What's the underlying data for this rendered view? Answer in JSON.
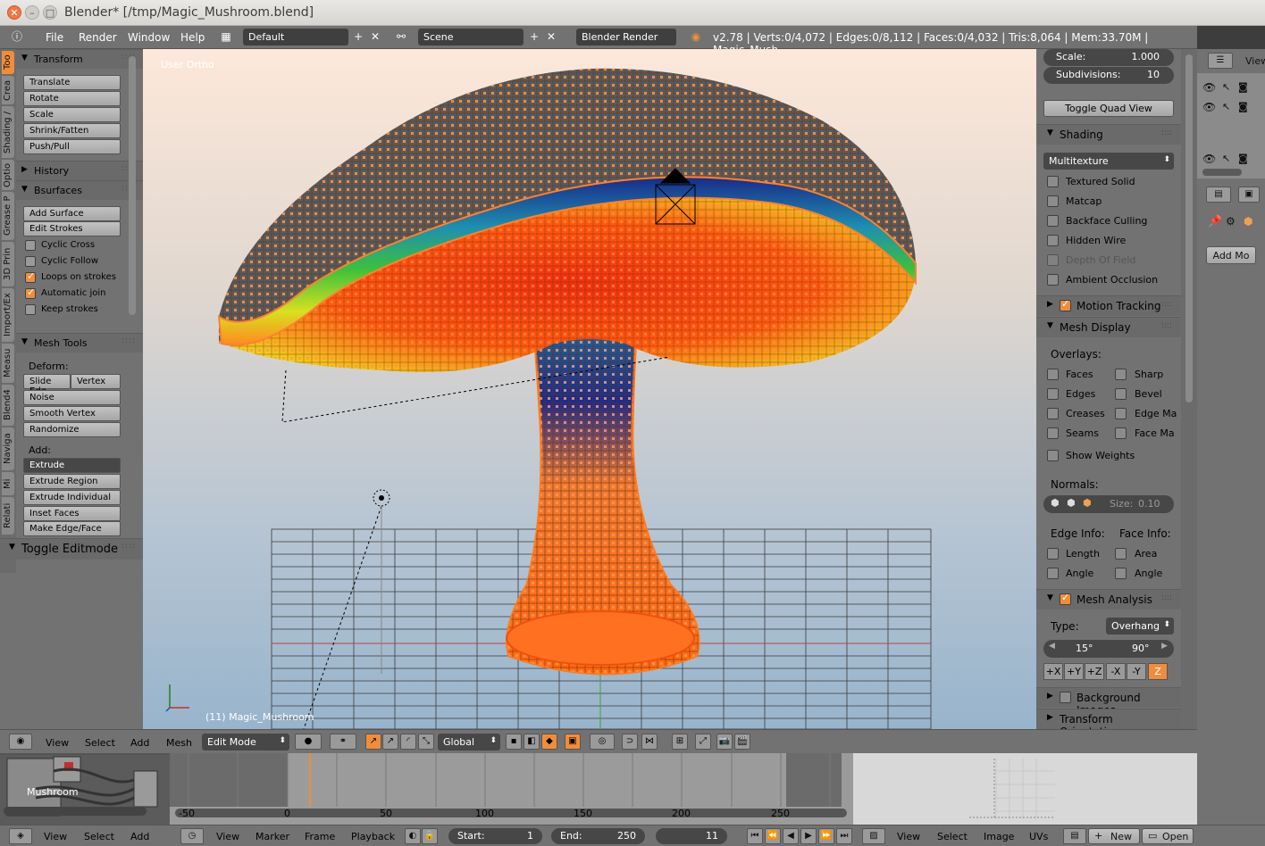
{
  "window": {
    "title": "Blender* [/tmp/Magic_Mushroom.blend]"
  },
  "info_header": {
    "menus": [
      "File",
      "Render",
      "Window",
      "Help"
    ],
    "screen_layout": "Default",
    "scene": "Scene",
    "render_engine": "Blender Render",
    "stats": "v2.78 | Verts:0/4,072 | Edges:0/8,112 | Faces:0/4,032 | Tris:8,064 | Mem:33.70M | Magic_Mush"
  },
  "tool_tabs": [
    "Too",
    "Crea",
    "Shading /",
    "Optio",
    "Grease P",
    "3D Prin",
    "Import/Ex",
    "Measu",
    "Blend4",
    "Naviga",
    "Mi",
    "Relati"
  ],
  "toolshelf": {
    "transform": {
      "title": "Transform",
      "buttons": [
        "Translate",
        "Rotate",
        "Scale",
        "Shrink/Fatten",
        "Push/Pull"
      ]
    },
    "history": {
      "title": "History"
    },
    "bsurfaces": {
      "title": "Bsurfaces",
      "buttons": [
        "Add Surface",
        "Edit Strokes"
      ],
      "checks": [
        {
          "label": "Cyclic Cross",
          "checked": false
        },
        {
          "label": "Cyclic Follow",
          "checked": false
        },
        {
          "label": "Loops on strokes",
          "checked": true
        },
        {
          "label": "Automatic join",
          "checked": true
        },
        {
          "label": "Keep strokes",
          "checked": false
        }
      ]
    },
    "mesh_tools": {
      "title": "Mesh Tools",
      "deform_label": "Deform:",
      "slide_edge": "Slide Edg",
      "vertex": "Vertex",
      "deform_buttons": [
        "Noise",
        "Smooth Vertex",
        "Randomize"
      ],
      "add_label": "Add:",
      "extrude": "Extrude",
      "add_buttons": [
        "Extrude Region",
        "Extrude Individual",
        "Inset Faces",
        "Make Edge/Face"
      ]
    },
    "toggle_editmode": "Toggle Editmode"
  },
  "viewport": {
    "view_name": "User Ortho",
    "object_label": "(11) Magic_Mushroom"
  },
  "npanel": {
    "scale": {
      "label": "Scale:",
      "value": "1.000"
    },
    "subdivisions": {
      "label": "Subdivisions:",
      "value": "10"
    },
    "toggle_quad": "Toggle Quad View",
    "shading": {
      "title": "Shading",
      "mode": "Multitexture",
      "checks": [
        {
          "label": "Textured Solid",
          "checked": false,
          "dim": false
        },
        {
          "label": "Matcap",
          "checked": false,
          "dim": false
        },
        {
          "label": "Backface Culling",
          "checked": false,
          "dim": false
        },
        {
          "label": "Hidden Wire",
          "checked": false,
          "dim": false
        },
        {
          "label": "Depth Of Field",
          "checked": false,
          "dim": true
        },
        {
          "label": "Ambient Occlusion",
          "checked": false,
          "dim": false
        }
      ]
    },
    "motion_tracking": "Motion Tracking",
    "mesh_display": {
      "title": "Mesh Display",
      "overlays": "Overlays:",
      "left": [
        "Faces",
        "Edges",
        "Creases",
        "Seams"
      ],
      "right": [
        "Sharp",
        "Bevel",
        "Edge Ma",
        "Face Ma"
      ],
      "show_weights": "Show Weights",
      "normals": "Normals:",
      "size": "Size:",
      "size_value": "0.10",
      "edge_info": "Edge Info:",
      "face_info": "Face Info:",
      "edge_checks": [
        "Length",
        "Angle"
      ],
      "face_checks": [
        "Area",
        "Angle"
      ]
    },
    "mesh_analysis": {
      "title": "Mesh Analysis",
      "type_label": "Type:",
      "type": "Overhang",
      "min": "15°",
      "max": "90°",
      "axes": [
        "+X",
        "+Y",
        "+Z",
        "-X",
        "-Y",
        "Z"
      ]
    },
    "background_images": "Background Images",
    "transform_orientations": "Transform Orientations"
  },
  "outliner": {
    "view_label": "View"
  },
  "properties": {
    "add_modifier": "Add Mo"
  },
  "view3d_header": {
    "menus": [
      "View",
      "Select",
      "Add",
      "Mesh"
    ],
    "mode": "Edit Mode",
    "orientation": "Global"
  },
  "node_editor": {
    "node_label": "Mushroom"
  },
  "timeline": {
    "ticks": [
      "-50",
      "0",
      "50",
      "100",
      "150",
      "200",
      "250"
    ],
    "current_frame_value": 11
  },
  "bottom_bar": {
    "node_menus": [
      "View",
      "Select",
      "Add"
    ],
    "timeline_menus": [
      "View",
      "Marker",
      "Frame",
      "Playback"
    ],
    "start_label": "Start:",
    "start": "1",
    "end_label": "End:",
    "end": "250",
    "current": "11",
    "image_menus": [
      "View",
      "Select",
      "Image",
      "UVs"
    ],
    "new": "New",
    "open": "Open"
  },
  "colors": {
    "accent": "#f08d3c",
    "panel": "#727272",
    "field": "#474747"
  }
}
